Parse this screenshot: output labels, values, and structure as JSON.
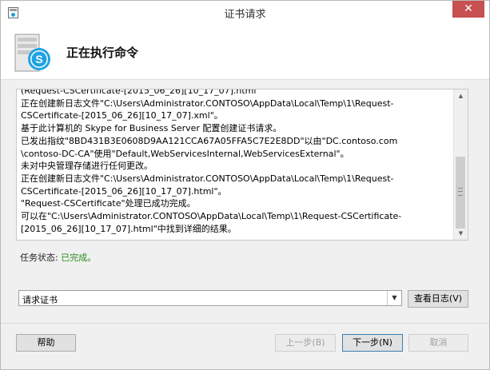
{
  "window": {
    "title": "证书请求",
    "close_glyph": "✕"
  },
  "header": {
    "heading": "正在执行命令",
    "logo_icon": "skype-server-icon"
  },
  "log": {
    "lines": [
      "(Request-CSCertificate-[2015_06_26][10_17_07].html",
      "正在创建新日志文件\"C:\\Users\\Administrator.CONTOSO\\AppData\\Local\\Temp\\1\\Request-",
      "CSCertificate-[2015_06_26][10_17_07].xml\"。",
      "基于此计算机的 Skype for Business Server 配置创建证书请求。",
      "已发出指纹\"8BD431B3E0608D9AA121CCA67A05FFA5C7E2E8DD\"以由\"DC.contoso.com",
      "\\contoso-DC-CA\"使用\"Default,WebServicesInternal,WebServicesExternal\"。",
      "未对中央管理存储进行任何更改。",
      "正在创建新日志文件\"C:\\Users\\Administrator.CONTOSO\\AppData\\Local\\Temp\\1\\Request-",
      "CSCertificate-[2015_06_26][10_17_07].html\"。",
      "\"Request-CSCertificate\"处理已成功完成。",
      "可以在\"C:\\Users\\Administrator.CONTOSO\\AppData\\Local\\Temp\\1\\Request-CSCertificate-",
      "[2015_06_26][10_17_07].html\"中找到详细的结果。"
    ]
  },
  "status": {
    "label": "任务状态:",
    "value": "已完成。"
  },
  "task_select": {
    "selected": "请求证书"
  },
  "buttons": {
    "view_log": "查看日志(V)",
    "help": "帮助",
    "back": "上一步(B)",
    "next": "下一步(N)",
    "cancel": "取消"
  }
}
